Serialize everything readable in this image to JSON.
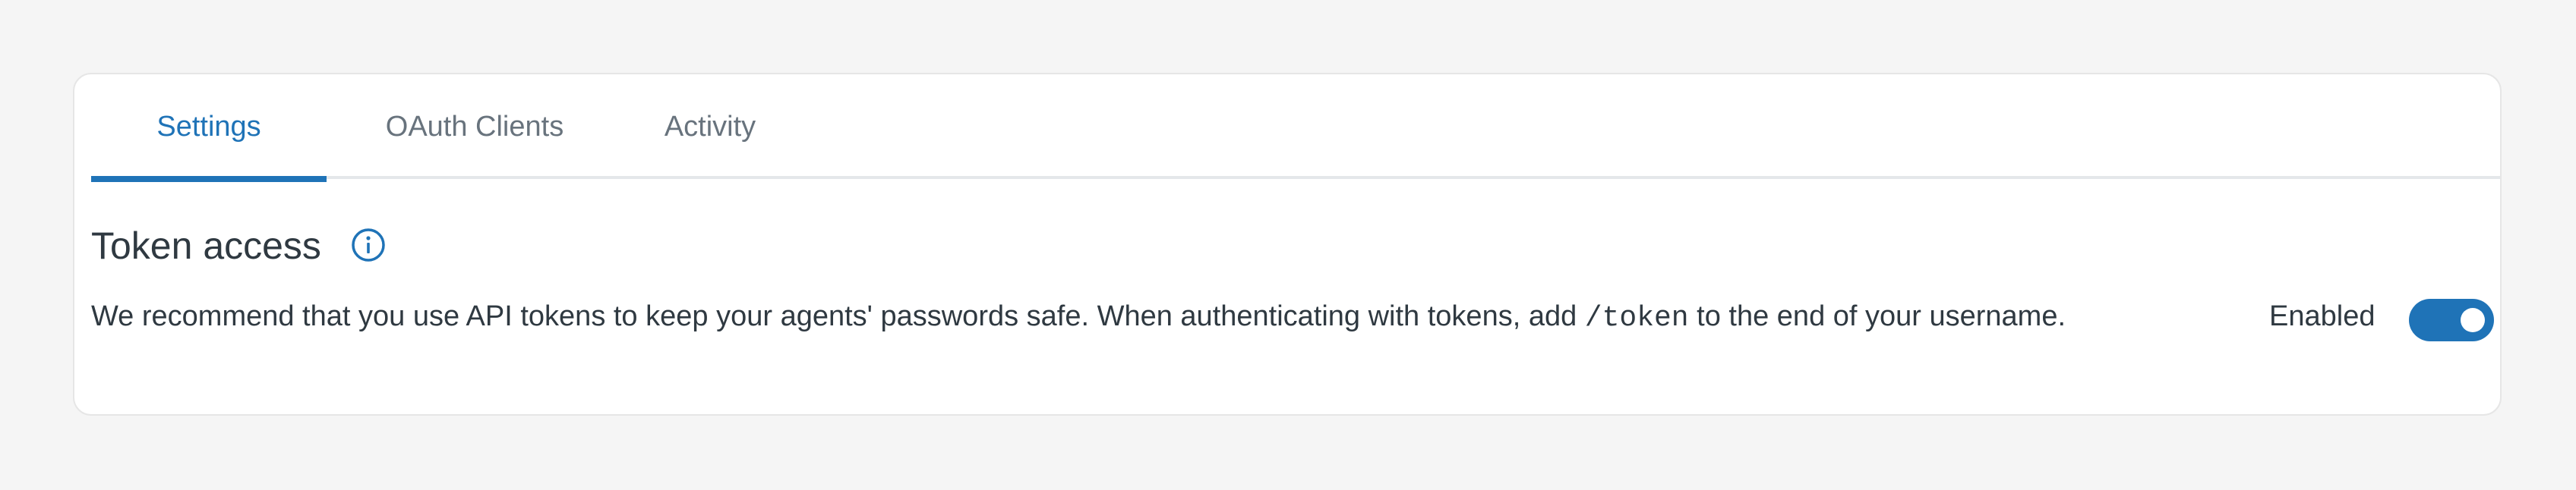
{
  "tabs": [
    {
      "label": "Settings",
      "active": true
    },
    {
      "label": "OAuth Clients",
      "active": false
    },
    {
      "label": "Activity",
      "active": false
    }
  ],
  "token_access": {
    "title": "Token access",
    "info_icon": "info-circle-icon",
    "description_before": "We recommend that you use API tokens to keep your agents' passwords safe. When authenticating with tokens, add ",
    "description_code": "/token",
    "description_after": " to the end of your username.",
    "toggle_label": "Enabled",
    "toggle_on": true
  },
  "colors": {
    "accent": "#1f73b7",
    "text": "#2f3941",
    "muted": "#68737d",
    "background": "#f5f5f5",
    "panel": "#ffffff",
    "border": "#e4e7ea"
  }
}
